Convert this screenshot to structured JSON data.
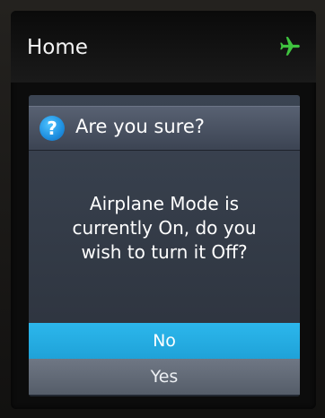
{
  "header": {
    "title": "Home",
    "icon": "airplane-icon",
    "icon_color": "#3fc33f"
  },
  "dialog": {
    "icon": "question-icon",
    "icon_glyph": "?",
    "title": "Are you sure?",
    "message_lines": [
      "Airplane Mode is",
      "currently On, do you",
      "wish to turn it Off?"
    ],
    "options": [
      {
        "label": "No",
        "selected": true
      },
      {
        "label": "Yes",
        "selected": false
      }
    ],
    "selected_color": "#2cb7ec"
  }
}
